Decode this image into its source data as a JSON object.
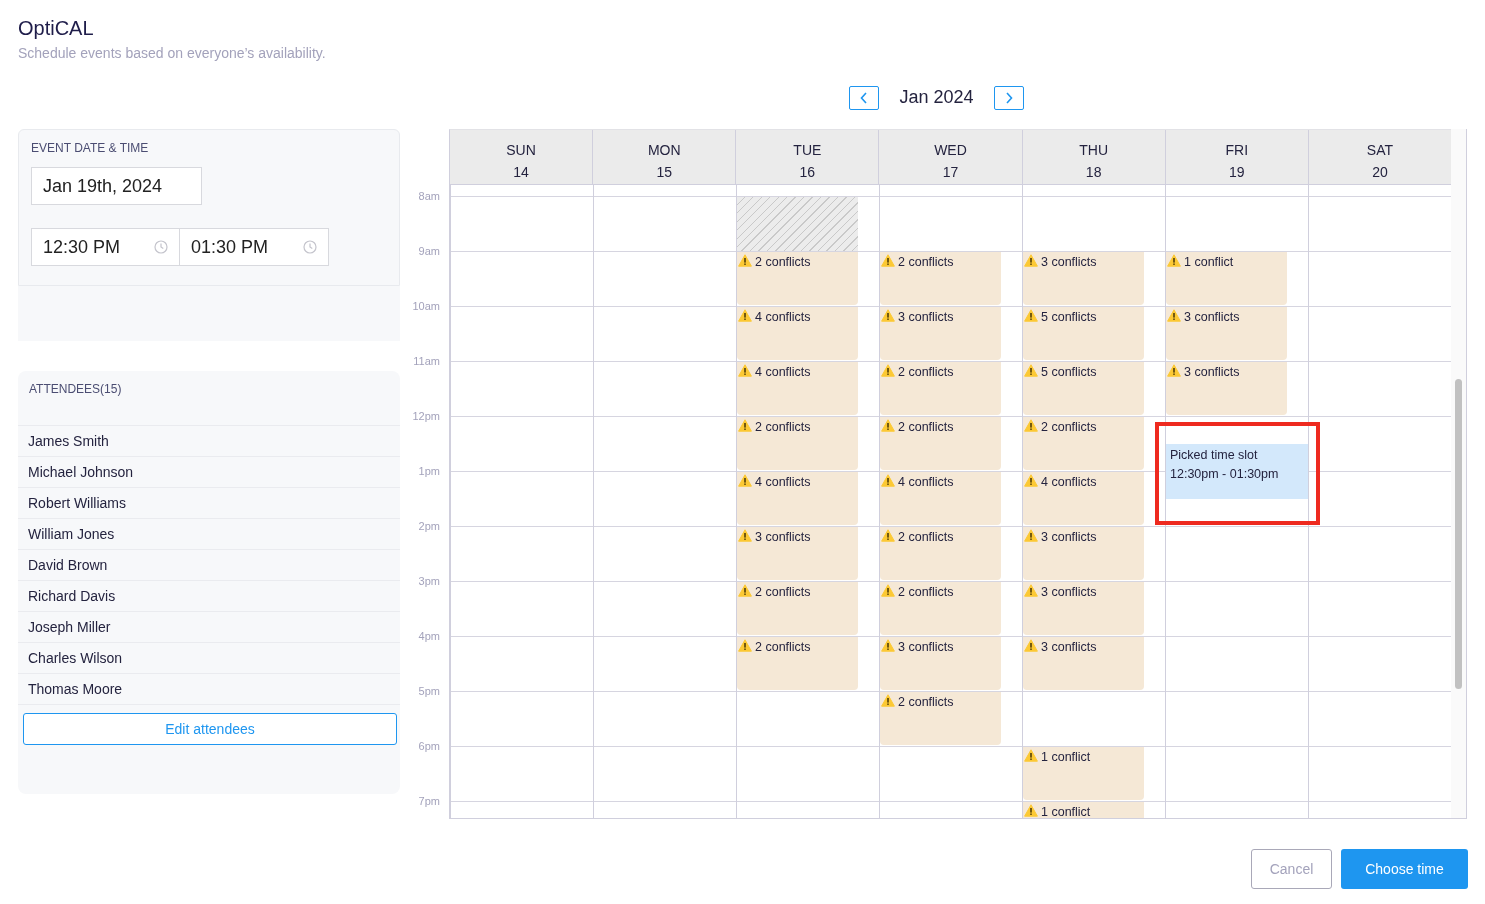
{
  "app": {
    "title": "OptiCAL",
    "subtitle": "Schedule events based on everyone’s availability."
  },
  "month_nav": {
    "label": "Jan 2024"
  },
  "event_panel": {
    "heading": "EVENT DATE & TIME",
    "date": "Jan 19th, 2024",
    "start_time": "12:30 PM",
    "end_time": "01:30 PM"
  },
  "attendees": {
    "heading": "ATTENDEES(15)",
    "names": [
      "James Smith",
      "Michael Johnson",
      "Robert Williams",
      "William Jones",
      "David Brown",
      "Richard Davis",
      "Joseph Miller",
      "Charles Wilson",
      "Thomas Moore"
    ],
    "edit_button": "Edit attendees"
  },
  "calendar": {
    "days": [
      {
        "weekday": "SUN",
        "date": "14"
      },
      {
        "weekday": "MON",
        "date": "15"
      },
      {
        "weekday": "TUE",
        "date": "16"
      },
      {
        "weekday": "WED",
        "date": "17"
      },
      {
        "weekday": "THU",
        "date": "18"
      },
      {
        "weekday": "FRI",
        "date": "19",
        "picked_slot": {
          "title": "Picked time slot",
          "time_range": "12:30pm - 01:30pm",
          "highlighted": true
        }
      },
      {
        "weekday": "SAT",
        "date": "20"
      }
    ],
    "rows": [
      {
        "time": "8am",
        "cells": [
          {
            "kind": "empty"
          },
          {
            "kind": "empty"
          },
          {
            "kind": "unavailable"
          },
          {
            "kind": "empty"
          },
          {
            "kind": "empty"
          },
          {
            "kind": "empty"
          },
          {
            "kind": "empty"
          }
        ]
      },
      {
        "time": "9am",
        "cells": [
          {
            "kind": "empty"
          },
          {
            "kind": "empty"
          },
          {
            "kind": "conflict",
            "text": "2 conflicts"
          },
          {
            "kind": "conflict",
            "text": "2 conflicts"
          },
          {
            "kind": "conflict",
            "text": "3 conflicts"
          },
          {
            "kind": "conflict",
            "text": "1 conflict"
          },
          {
            "kind": "empty"
          }
        ]
      },
      {
        "time": "10am",
        "cells": [
          {
            "kind": "empty"
          },
          {
            "kind": "empty"
          },
          {
            "kind": "conflict",
            "text": "4 conflicts"
          },
          {
            "kind": "conflict",
            "text": "3 conflicts"
          },
          {
            "kind": "conflict",
            "text": "5 conflicts"
          },
          {
            "kind": "conflict",
            "text": "3 conflicts"
          },
          {
            "kind": "empty"
          }
        ]
      },
      {
        "time": "11am",
        "cells": [
          {
            "kind": "empty"
          },
          {
            "kind": "empty"
          },
          {
            "kind": "conflict",
            "text": "4 conflicts"
          },
          {
            "kind": "conflict",
            "text": "2 conflicts"
          },
          {
            "kind": "conflict",
            "text": "5 conflicts"
          },
          {
            "kind": "conflict",
            "text": "3 conflicts"
          },
          {
            "kind": "empty"
          }
        ]
      },
      {
        "time": "12pm",
        "cells": [
          {
            "kind": "empty"
          },
          {
            "kind": "empty"
          },
          {
            "kind": "conflict",
            "text": "2 conflicts"
          },
          {
            "kind": "conflict",
            "text": "2 conflicts"
          },
          {
            "kind": "conflict",
            "text": "2 conflicts"
          },
          {
            "kind": "empty"
          },
          {
            "kind": "empty"
          }
        ]
      },
      {
        "time": "1pm",
        "cells": [
          {
            "kind": "empty"
          },
          {
            "kind": "empty"
          },
          {
            "kind": "conflict",
            "text": "4 conflicts"
          },
          {
            "kind": "conflict",
            "text": "4 conflicts"
          },
          {
            "kind": "conflict",
            "text": "4 conflicts"
          },
          {
            "kind": "empty"
          },
          {
            "kind": "empty"
          }
        ]
      },
      {
        "time": "2pm",
        "cells": [
          {
            "kind": "empty"
          },
          {
            "kind": "empty"
          },
          {
            "kind": "conflict",
            "text": "3 conflicts"
          },
          {
            "kind": "conflict",
            "text": "2 conflicts"
          },
          {
            "kind": "conflict",
            "text": "3 conflicts"
          },
          {
            "kind": "empty"
          },
          {
            "kind": "empty"
          }
        ]
      },
      {
        "time": "3pm",
        "cells": [
          {
            "kind": "empty"
          },
          {
            "kind": "empty"
          },
          {
            "kind": "conflict",
            "text": "2 conflicts"
          },
          {
            "kind": "conflict",
            "text": "2 conflicts"
          },
          {
            "kind": "conflict",
            "text": "3 conflicts"
          },
          {
            "kind": "empty"
          },
          {
            "kind": "empty"
          }
        ]
      },
      {
        "time": "4pm",
        "cells": [
          {
            "kind": "empty"
          },
          {
            "kind": "empty"
          },
          {
            "kind": "conflict",
            "text": "2 conflicts"
          },
          {
            "kind": "conflict",
            "text": "3 conflicts"
          },
          {
            "kind": "conflict",
            "text": "3 conflicts"
          },
          {
            "kind": "empty"
          },
          {
            "kind": "empty"
          }
        ]
      },
      {
        "time": "5pm",
        "cells": [
          {
            "kind": "empty"
          },
          {
            "kind": "empty"
          },
          {
            "kind": "empty"
          },
          {
            "kind": "conflict",
            "text": "2 conflicts"
          },
          {
            "kind": "empty"
          },
          {
            "kind": "empty"
          },
          {
            "kind": "empty"
          }
        ]
      },
      {
        "time": "6pm",
        "cells": [
          {
            "kind": "empty"
          },
          {
            "kind": "empty"
          },
          {
            "kind": "empty"
          },
          {
            "kind": "empty"
          },
          {
            "kind": "conflict",
            "text": "1 conflict"
          },
          {
            "kind": "empty"
          },
          {
            "kind": "empty"
          }
        ]
      },
      {
        "time": "7pm",
        "cells": [
          {
            "kind": "empty"
          },
          {
            "kind": "empty"
          },
          {
            "kind": "empty"
          },
          {
            "kind": "empty"
          },
          {
            "kind": "conflict",
            "text": "1 conflict"
          },
          {
            "kind": "empty"
          },
          {
            "kind": "empty"
          }
        ]
      }
    ]
  },
  "buttons": [
    {
      "label": "Cancel",
      "kind": "secondary"
    },
    {
      "label": "Choose time",
      "kind": "primary"
    }
  ]
}
